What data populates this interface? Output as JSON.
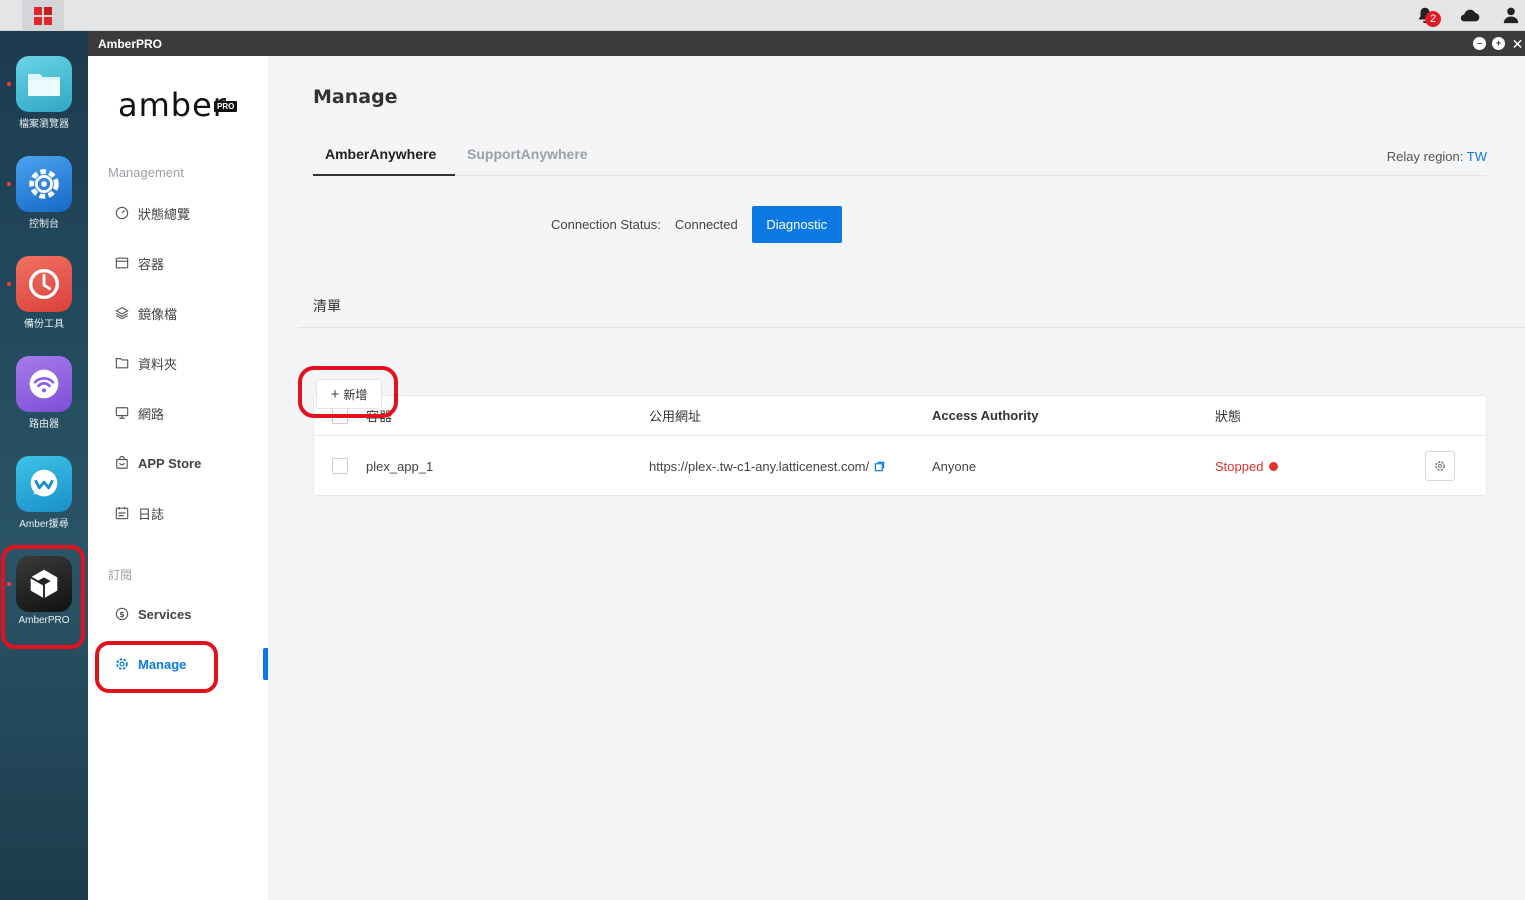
{
  "window": {
    "title": "AmberPRO"
  },
  "topbar": {
    "notification_count": "2"
  },
  "dock": {
    "items": [
      {
        "label": "檔案瀏覽器"
      },
      {
        "label": "控制台"
      },
      {
        "label": "備份工具"
      },
      {
        "label": "路由器"
      },
      {
        "label": "Amber援尋"
      },
      {
        "label": "AmberPRO"
      }
    ]
  },
  "sidebar": {
    "logo": "amber",
    "logo_tag": "PRO",
    "section_management": "Management",
    "items": [
      {
        "label": "狀態總覽"
      },
      {
        "label": "容器"
      },
      {
        "label": "鏡像檔"
      },
      {
        "label": "資料夾"
      },
      {
        "label": "網路"
      },
      {
        "label": "APP Store"
      },
      {
        "label": "日誌"
      }
    ],
    "section_subscription": "訂閱",
    "sub_items": [
      {
        "label": "Services"
      },
      {
        "label": "Manage"
      }
    ]
  },
  "main": {
    "title": "Manage",
    "tabs": [
      {
        "label": "AmberAnywhere"
      },
      {
        "label": "SupportAnywhere"
      }
    ],
    "relay_label": "Relay region:",
    "relay_value": "TW",
    "connection_label": "Connection Status:",
    "connection_value": "Connected",
    "diagnostic_label": "Diagnostic",
    "list_title": "清單",
    "add_label": "新增",
    "table": {
      "headers": [
        "容器",
        "公用網址",
        "Access Authority",
        "狀態"
      ],
      "rows": [
        {
          "name": "plex_app_1",
          "url": "https://plex-.tw-c1-any.latticenest.com/",
          "access": "Anyone",
          "status": "Stopped"
        }
      ]
    }
  },
  "colors": {
    "accent": "#0b78e3",
    "highlight": "#e3101d",
    "stopped": "#e03131"
  }
}
